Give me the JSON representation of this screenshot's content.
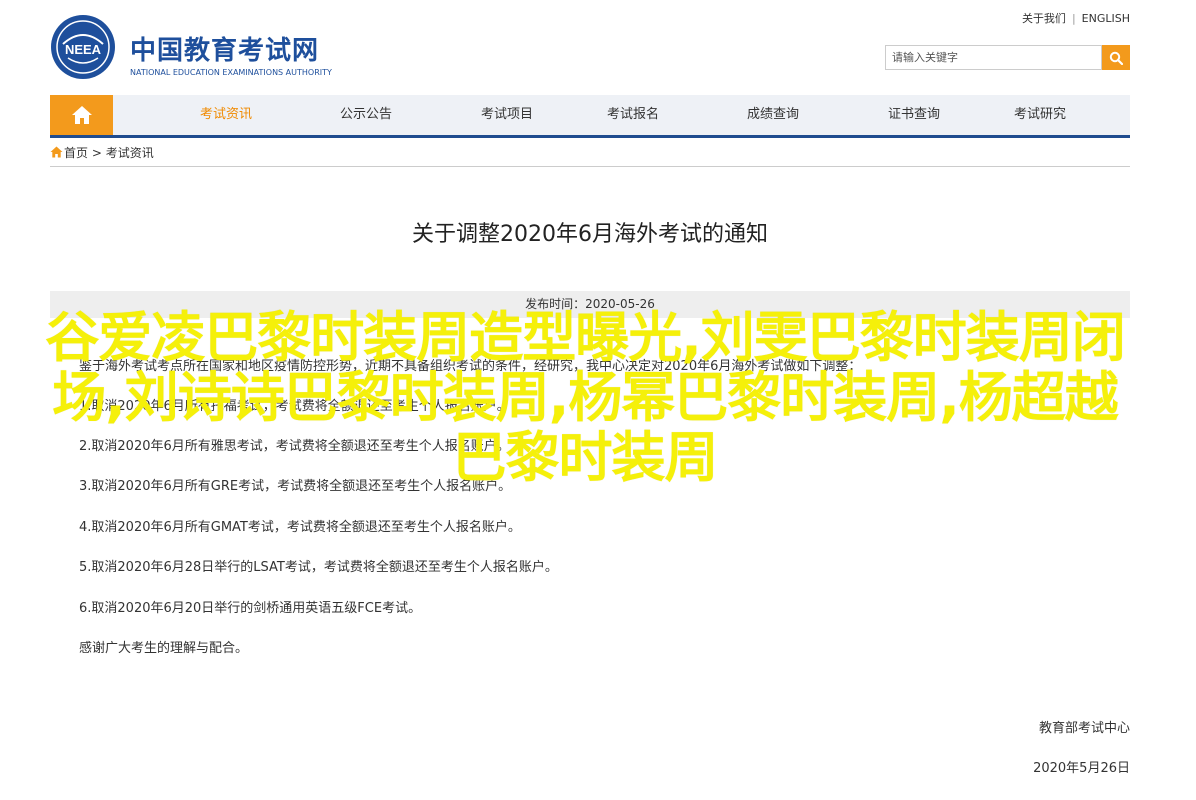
{
  "header": {
    "logo_cn": "中国教育考试网",
    "logo_en": "NATIONAL EDUCATION EXAMINATIONS AUTHORITY",
    "emblem_text": "NEEA",
    "links": [
      "关于我们",
      "ENGLISH"
    ],
    "search_placeholder": "请输入关键字"
  },
  "nav": {
    "items": [
      "考试资讯",
      "公示公告",
      "考试项目",
      "考试报名",
      "成绩查询",
      "证书查询",
      "考试研究"
    ],
    "active": "考试资讯",
    "accent": "#f39a1c",
    "bar_color": "#1f4c8f"
  },
  "breadcrumb": {
    "home": "首页",
    "sep": " > ",
    "current": "考试资讯"
  },
  "article": {
    "title": "关于调整2020年6月海外考试的通知",
    "meta": "发布时间：2020-05-26",
    "lead": "鉴于海外考试考点所在国家和地区疫情防控形势，近期不具备组织考试的条件，经研究，我中心决定对2020年6月海外考试做如下调整：",
    "items": [
      "1.取消2020年6月所有托福考试，考试费将全额退还至考生个人报名账户。",
      "2.取消2020年6月所有雅思考试，考试费将全额退还至考生个人报名账户。",
      "3.取消2020年6月所有GRE考试，考试费将全额退还至考生个人报名账户。",
      "4.取消2020年6月所有GMAT考试，考试费将全额退还至考生个人报名账户。",
      "5.取消2020年6月28日举行的LSAT考试，考试费将全额退还至考生个人报名账户。",
      "6.取消2020年6月20日举行的剑桥通用英语五级FCE考试。"
    ],
    "thanks": "感谢广大考生的理解与配合。",
    "signature": "教育部考试中心",
    "date": "2020年5月26日"
  },
  "overlay": {
    "text": "谷爱凌巴黎时装周造型曝光,刘雯巴黎时装周闭场,刘诗诗巴黎时装周,杨幂巴黎时装周,杨超越巴黎时装周",
    "color": "#f5f00a"
  }
}
